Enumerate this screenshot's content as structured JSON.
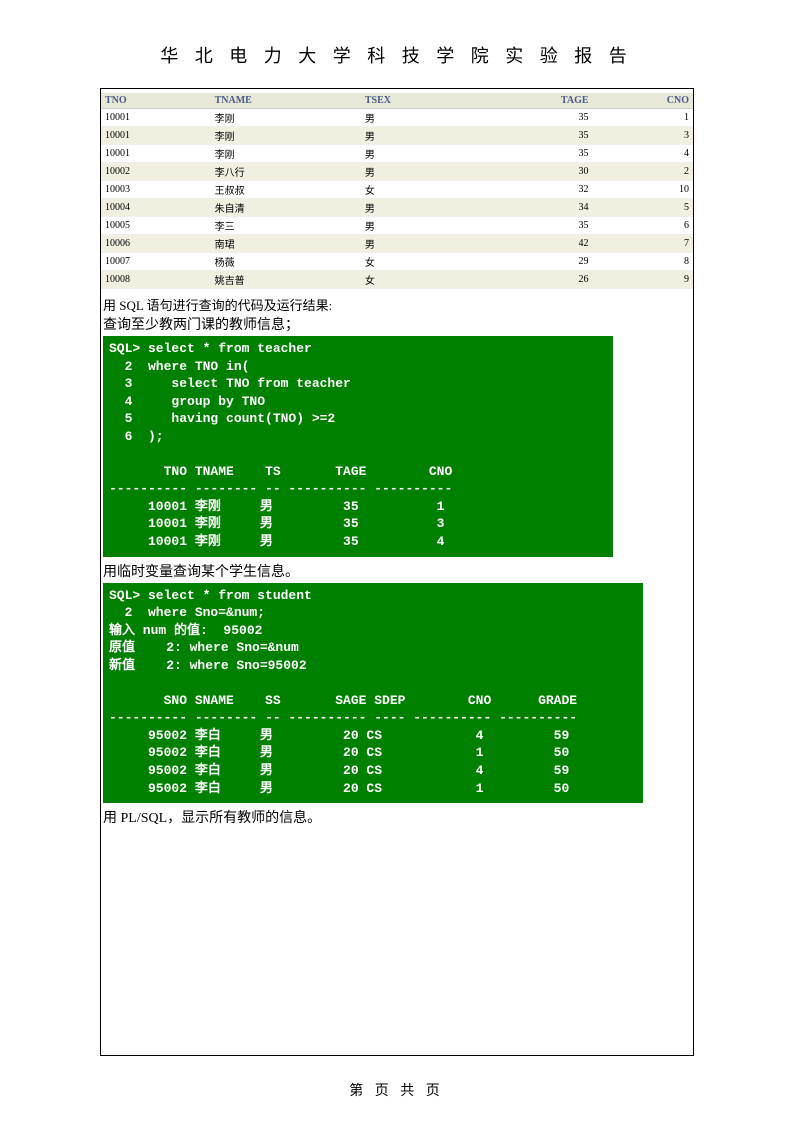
{
  "title": "华 北 电 力 大 学 科 技 学 院 实 验 报 告",
  "footer": "第   页 共   页",
  "table": {
    "headers": [
      "TNO",
      "TNAME",
      "TSEX",
      "TAGE",
      "CNO"
    ],
    "rows": [
      {
        "tno": "10001",
        "tname": "李刚",
        "tsex": "男",
        "tage": "35",
        "cno": "1"
      },
      {
        "tno": "10001",
        "tname": "李刚",
        "tsex": "男",
        "tage": "35",
        "cno": "3"
      },
      {
        "tno": "10001",
        "tname": "李刚",
        "tsex": "男",
        "tage": "35",
        "cno": "4"
      },
      {
        "tno": "10002",
        "tname": "李八行",
        "tsex": "男",
        "tage": "30",
        "cno": "2"
      },
      {
        "tno": "10003",
        "tname": "王叔叔",
        "tsex": "女",
        "tage": "32",
        "cno": "10"
      },
      {
        "tno": "10004",
        "tname": "朱自清",
        "tsex": "男",
        "tage": "34",
        "cno": "5"
      },
      {
        "tno": "10005",
        "tname": "李三",
        "tsex": "男",
        "tage": "35",
        "cno": "6"
      },
      {
        "tno": "10006",
        "tname": "南珺",
        "tsex": "男",
        "tage": "42",
        "cno": "7"
      },
      {
        "tno": "10007",
        "tname": "杨薇",
        "tsex": "女",
        "tage": "29",
        "cno": "8"
      },
      {
        "tno": "10008",
        "tname": "姚吉普",
        "tsex": "女",
        "tage": "26",
        "cno": "9"
      }
    ]
  },
  "text_before_query1": "用 SQL 语句进行查询的代码及运行结果:",
  "heading_query1": "查询至少教两门课的教师信息；",
  "terminal1": "SQL> select * from teacher\n  2  where TNO in(\n  3     select TNO from teacher\n  4     group by TNO\n  5     having count(TNO) >=2\n  6  );\n\n       TNO TNAME    TS       TAGE        CNO\n---------- -------- -- ---------- ----------\n     10001 李刚     男         35          1\n     10001 李刚     男         35          3\n     10001 李刚     男         35          4",
  "heading_query2": "用临时变量查询某个学生信息。",
  "terminal2": "SQL> select * from student\n  2  where Sno=&num;\n输入 num 的值:  95002\n原值    2: where Sno=&num\n新值    2: where Sno=95002\n\n       SNO SNAME    SS       SAGE SDEP        CNO      GRADE\n---------- -------- -- ---------- ---- ---------- ----------\n     95002 李白     男         20 CS            4         59\n     95002 李白     男         20 CS            1         50\n     95002 李白     男         20 CS            4         59\n     95002 李白     男         20 CS            1         50",
  "heading_query3": "用  PL/SQL，显示所有教师的信息。"
}
